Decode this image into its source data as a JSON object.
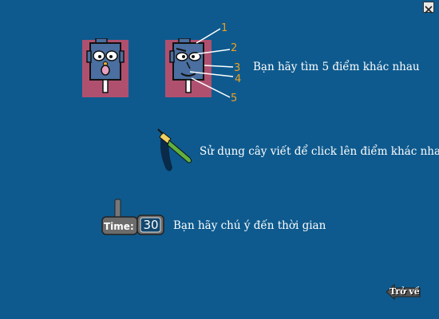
{
  "instructions": {
    "find_differences": "Bạn hãy tìm 5 điểm khác nhau",
    "use_pen": "Sử dụng cây viết để click lên điểm khác nhau",
    "watch_time": "Bạn hãy chú ý đến thời gian"
  },
  "markers": [
    "1",
    "2",
    "3",
    "4",
    "5"
  ],
  "timer": {
    "label": "Time:",
    "value": "30"
  },
  "back_button": {
    "label": "Trở về"
  },
  "colors": {
    "background": "#0e5a8e",
    "frame": "#b0506f",
    "face": "#4a6fa0",
    "marker": "#f0a020"
  }
}
